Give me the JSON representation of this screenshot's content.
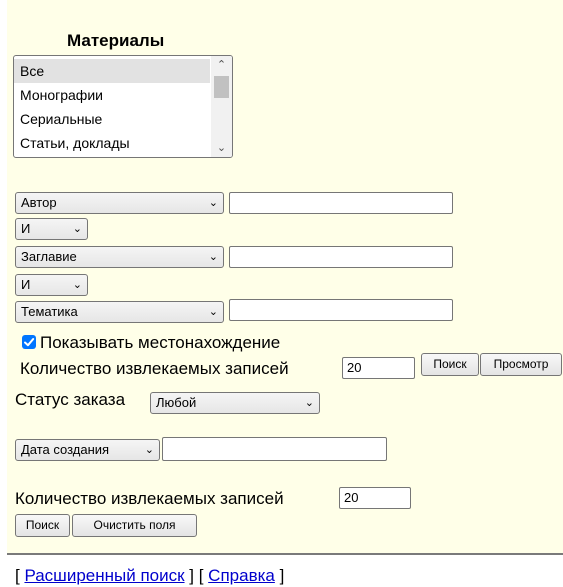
{
  "materials": {
    "title": "Материалы",
    "options": [
      "Все",
      "Монографии",
      "Сериальные",
      "Статьи, доклады"
    ],
    "selected": "Все"
  },
  "search_rows": [
    {
      "field": "Автор",
      "value": ""
    },
    {
      "operator": "И"
    },
    {
      "field": "Заглавие",
      "value": ""
    },
    {
      "operator": "И"
    },
    {
      "field": "Тематика",
      "value": ""
    }
  ],
  "show_location": {
    "label": "Показывать местонахождение",
    "checked": true
  },
  "records_count_1": {
    "label": "Количество извлекаемых записей",
    "value": "20"
  },
  "buttons_1": {
    "search": "Поиск",
    "view": "Просмотр"
  },
  "order_status": {
    "label": "Статус заказа",
    "value": "Любой"
  },
  "date_filter": {
    "field": "Дата создания",
    "value": ""
  },
  "records_count_2": {
    "label": "Количество извлекаемых записей",
    "value": "20"
  },
  "buttons_2": {
    "search": "Поиск",
    "clear": "Очистить поля"
  },
  "footer": {
    "open1": "[ ",
    "advanced_link": "Расширенный поиск",
    "mid": " ] [ ",
    "help_link": "Справка",
    "close": " ]"
  },
  "colors": {
    "panel_bg": "#ffffe8",
    "link": "#0000cc",
    "checkbox": "#0075ff"
  }
}
